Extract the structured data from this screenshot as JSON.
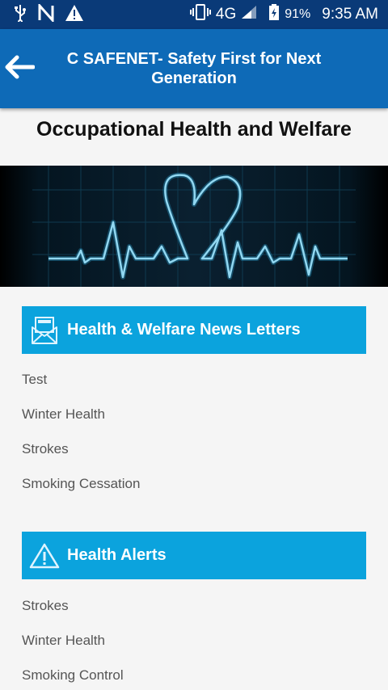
{
  "status_bar": {
    "network": "4G",
    "battery": "91%",
    "time": "9:35 AM"
  },
  "app_bar": {
    "title": "C SAFENET- Safety First for Next Generation"
  },
  "page": {
    "title": "Occupational Health and Welfare"
  },
  "sections": [
    {
      "title": "Health & Welfare News Letters",
      "icon": "newsletter-icon",
      "items": [
        "Test",
        "Winter Health",
        "Strokes",
        "Smoking Cessation"
      ]
    },
    {
      "title": "Health Alerts",
      "icon": "warning-icon",
      "items": [
        "Strokes",
        "Winter Health",
        "Smoking Control"
      ]
    }
  ],
  "colors": {
    "status_bar": "#0a3a78",
    "app_bar": "#0e6ab7",
    "section_header": "#0ba3dd",
    "background": "#f5f5f5"
  }
}
